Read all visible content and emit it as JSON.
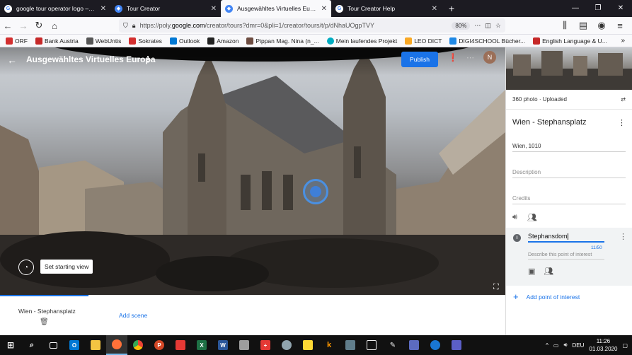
{
  "browser": {
    "tabs": [
      {
        "title": "google tour operator logo – Go",
        "icon": "google-icon",
        "color": "#ffffff",
        "active": false
      },
      {
        "title": "Tour Creator",
        "icon": "tour-creator-icon",
        "color": "#4285f4",
        "active": false
      },
      {
        "title": "Ausgewähltes Virtuelles Europa",
        "icon": "tour-creator-icon",
        "color": "#4285f4",
        "active": true
      },
      {
        "title": "Tour Creator Help",
        "icon": "google-icon",
        "color": "#ffffff",
        "active": false
      }
    ],
    "new_tab": "+",
    "url_prefix": "https://poly.",
    "url_domain": "google.com",
    "url_rest": "/creator/tours?dmr=0&pli=1/creator/tours/t/p/dNhaUOgpTVY",
    "zoom": "80%",
    "bookmarks": [
      {
        "label": "ORF",
        "color": "#d32f2f"
      },
      {
        "label": "Bank Austria",
        "color": "#c62828"
      },
      {
        "label": "WebUntis",
        "color": "#555555"
      },
      {
        "label": "Sokrates",
        "color": "#d32f2f"
      },
      {
        "label": "Outlook",
        "color": "#0078d4"
      },
      {
        "label": "Amazon",
        "color": "#222222"
      },
      {
        "label": "Pippan Mag. Nina (n_...",
        "color": "#6d4c41"
      },
      {
        "label": "Mein laufendes Projekt",
        "color": "#00acc1"
      },
      {
        "label": "LEO DICT",
        "color": "#f9a825"
      },
      {
        "label": "DIGI4SCHOOL Bücher...",
        "color": "#1e88e5"
      },
      {
        "label": "English Language & U...",
        "color": "#c62828"
      }
    ],
    "bookmarks_more": "»"
  },
  "app": {
    "tour_title": "Ausgewähltes Virtuelles Europa",
    "publish_label": "Publish",
    "avatar_letter": "N",
    "avatar_color": "#9b6f58",
    "accent_color": "#1a73e8",
    "set_starting_view": "Set starting view",
    "scene_strip": {
      "scene_name": "Wien - Stephansplatz",
      "add_scene": "Add scene"
    }
  },
  "side_panel": {
    "photo_info": "360 photo · Uploaded",
    "scene_title": "Wien - Stephansplatz",
    "location": "Wien, 1010",
    "description_placeholder": "Description",
    "credits_placeholder": "Credits",
    "poi": {
      "title_value": "Stephansdom",
      "char_count": "11/50",
      "description_placeholder": "Describe this point of interest"
    },
    "add_poi": "Add point of interest"
  },
  "taskbar": {
    "apps": [
      {
        "name": "start",
        "color": "#ffffff",
        "glyph": ""
      },
      {
        "name": "search",
        "color": "#111111",
        "glyph": ""
      },
      {
        "name": "task-view",
        "color": "#111111",
        "glyph": ""
      },
      {
        "name": "outlook",
        "color": "#0078d4",
        "glyph": "O"
      },
      {
        "name": "file-explorer",
        "color": "#f4c542",
        "glyph": ""
      },
      {
        "name": "firefox",
        "color": "#ff7139",
        "glyph": ""
      },
      {
        "name": "chrome",
        "color": "#4caf50",
        "glyph": ""
      },
      {
        "name": "powerpoint",
        "color": "#d24726",
        "glyph": "P"
      },
      {
        "name": "acrobat",
        "color": "#e53935",
        "glyph": ""
      },
      {
        "name": "excel",
        "color": "#1e7145",
        "glyph": "X"
      },
      {
        "name": "word",
        "color": "#2b579a",
        "glyph": "W"
      },
      {
        "name": "media",
        "color": "#9e9e9e",
        "glyph": ""
      },
      {
        "name": "swiss",
        "color": "#e53935",
        "glyph": "+"
      },
      {
        "name": "app-person",
        "color": "#90a4ae",
        "glyph": ""
      },
      {
        "name": "sticky-notes",
        "color": "#fdd835",
        "glyph": ""
      },
      {
        "name": "k-app",
        "color": "#111111",
        "glyph": "k"
      },
      {
        "name": "calculator",
        "color": "#607d8b",
        "glyph": ""
      },
      {
        "name": "library",
        "color": "#eeeeee",
        "glyph": ""
      },
      {
        "name": "pen-app",
        "color": "#eeeeee",
        "glyph": ""
      },
      {
        "name": "photos",
        "color": "#5c6bc0",
        "glyph": ""
      },
      {
        "name": "sync",
        "color": "#1976d2",
        "glyph": ""
      },
      {
        "name": "teams",
        "color": "#5b5fc7",
        "glyph": ""
      }
    ],
    "language": "DEU",
    "time": "11:26",
    "date": "01.03.2020"
  }
}
